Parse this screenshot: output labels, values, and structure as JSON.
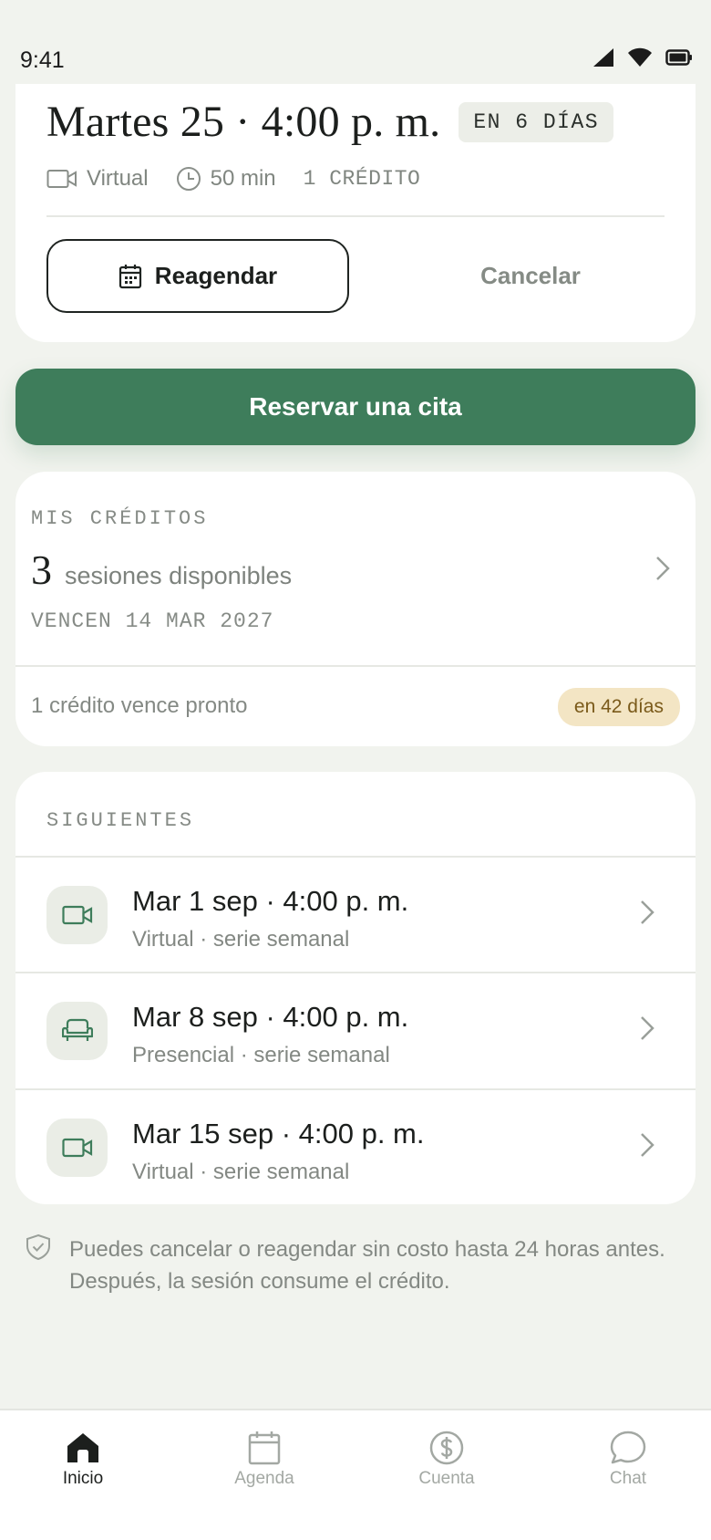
{
  "status_bar": {
    "time": "9:41"
  },
  "appointment": {
    "title": "Martes 25 · 4:00 p. m.",
    "badge": "EN 6 DÍAS",
    "mode": "Virtual",
    "duration": "50 min",
    "credits": "1 CRÉDITO",
    "reschedule_label": "Reagendar",
    "cancel_label": "Cancelar"
  },
  "book_button": "Reservar una cita",
  "credits": {
    "label": "MIS CRÉDITOS",
    "count": "3",
    "text": "sesiones disponibles",
    "expiry": "VENCEN 14 MAR 2027",
    "note": "1 crédito vence pronto",
    "pill": "en 42 días"
  },
  "next": {
    "label": "SIGUIENTES",
    "items": [
      {
        "title": "Mar 1 sep · 4:00 p. m.",
        "subtitle": "Virtual · serie semanal",
        "icon": "video-icon"
      },
      {
        "title": "Mar 8 sep · 4:00 p. m.",
        "subtitle": "Presencial · serie semanal",
        "icon": "armchair-icon"
      },
      {
        "title": "Mar 15 sep · 4:00 p. m.",
        "subtitle": "Virtual · serie semanal",
        "icon": "video-icon"
      }
    ]
  },
  "policy": {
    "line1": "Puedes cancelar o reagendar sin costo hasta 24 horas antes.",
    "line2": "Después, la sesión consume el crédito."
  },
  "tabs": [
    {
      "label": "Inicio",
      "icon": "home-icon",
      "active": true
    },
    {
      "label": "Agenda",
      "icon": "calendar-icon",
      "active": false
    },
    {
      "label": "Cuenta",
      "icon": "dollar-circle-icon",
      "active": false
    },
    {
      "label": "Chat",
      "icon": "chat-bubble-icon",
      "active": false
    }
  ],
  "colors": {
    "background": "#f1f3ee",
    "accent": "#3e7d5b",
    "warning_pill": "#f3e5c4"
  }
}
